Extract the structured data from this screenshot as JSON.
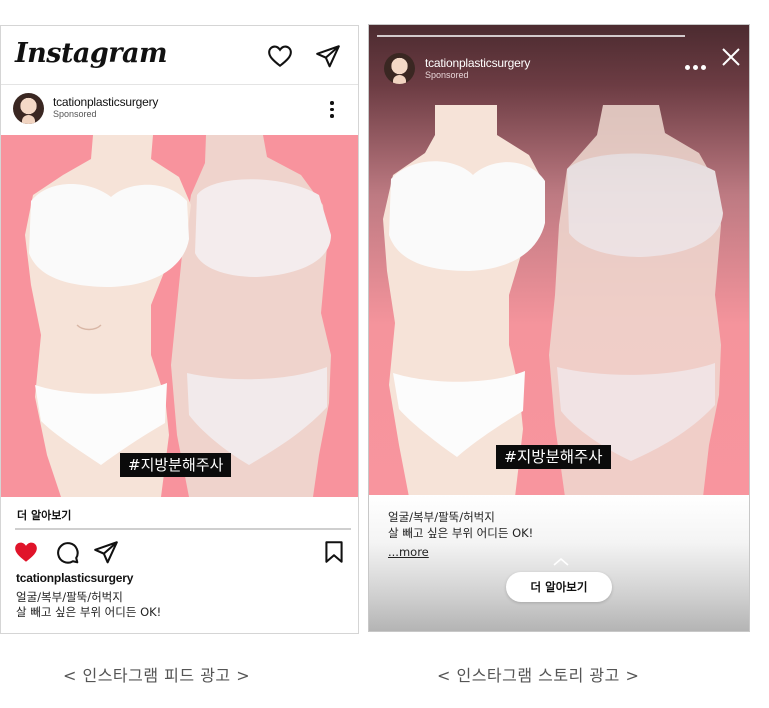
{
  "feed": {
    "logo": "Instagram",
    "icons": [
      "heart-icon",
      "send-icon",
      "more-vertical-icon",
      "like-filled-heart-icon",
      "comment-icon",
      "share-icon",
      "bookmark-icon"
    ],
    "username": "tcationplasticsurgery",
    "sponsored": "Sponsored",
    "hashtag": "#지방분해주사",
    "learn_more": "더 알아보기",
    "caption_user": "tcationplasticsurgery",
    "caption_lines": [
      "얼굴/복부/팔뚝/허벅지",
      "살 빼고 싶은 부위 어디든 OK!"
    ],
    "colors": {
      "like": "#e0142a",
      "image_bg": "#f8939d"
    }
  },
  "story": {
    "username": "tcationplasticsurgery",
    "sponsored": "Sponsored",
    "hashtag": "#지방분해주사",
    "caption_lines": [
      "얼굴/복부/팔뚝/허벅지",
      "살 빼고 싶은 부위 어디든 OK!"
    ],
    "more": "...more",
    "cta_button": "더 알아보기"
  },
  "labels": {
    "feed": "< 인스타그램 피드 광고 >",
    "story": "< 인스타그램 스토리 광고 >"
  }
}
